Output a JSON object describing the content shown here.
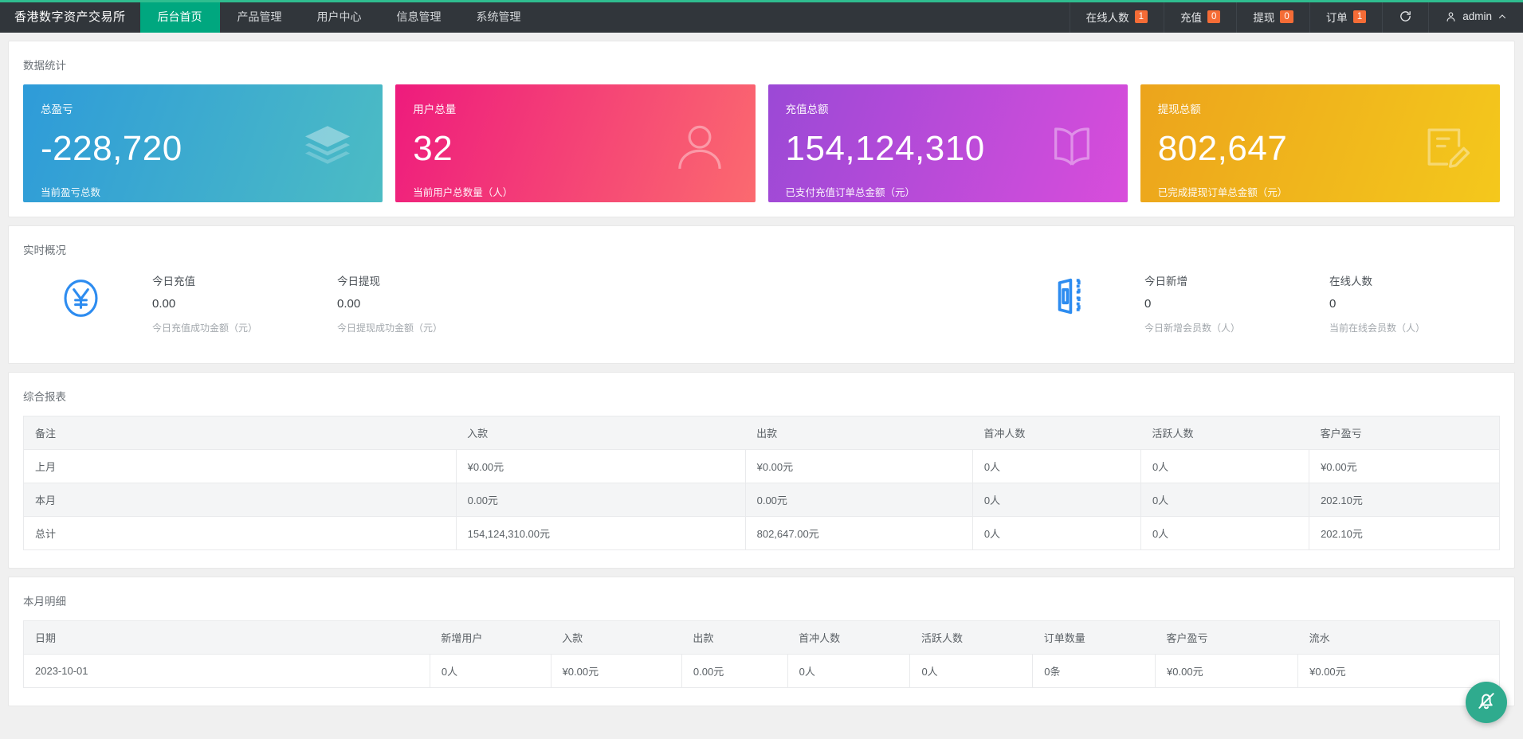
{
  "topbar": {
    "brand": "香港数字资产交易所",
    "nav": [
      {
        "label": "后台首页",
        "active": true
      },
      {
        "label": "产品管理",
        "active": false
      },
      {
        "label": "用户中心",
        "active": false
      },
      {
        "label": "信息管理",
        "active": false
      },
      {
        "label": "系统管理",
        "active": false
      }
    ],
    "right": [
      {
        "label": "在线人数",
        "badge": "1"
      },
      {
        "label": "充值",
        "badge": "0"
      },
      {
        "label": "提现",
        "badge": "0"
      },
      {
        "label": "订单",
        "badge": "1"
      }
    ],
    "refresh_icon": "refresh-icon",
    "user": "admin",
    "accent": "#2fbd8f",
    "badge_color": "#f56c36"
  },
  "stats": {
    "title": "数据统计",
    "cards": [
      {
        "label": "总盈亏",
        "value": "-228,720",
        "sub": "当前盈亏总数",
        "icon": "layers-icon",
        "color": "#2e9bd9"
      },
      {
        "label": "用户总量",
        "value": "32",
        "sub": "当前用户总数量（人）",
        "icon": "user-icon",
        "color": "#ee1b7d"
      },
      {
        "label": "充值总额",
        "value": "154,124,310",
        "sub": "已支付充值订单总金额（元）",
        "icon": "book-icon",
        "color": "#9b49d6"
      },
      {
        "label": "提现总额",
        "value": "802,647",
        "sub": "已完成提现订单总金额（元）",
        "icon": "edit-doc-icon",
        "color": "#eca41c"
      }
    ]
  },
  "realtime": {
    "title": "实时概况",
    "icon_left": "yuan-circle-icon",
    "icon_mid": "card-dashed-icon",
    "blocks_left": [
      {
        "title": "今日充值",
        "value": "0.00",
        "sub": "今日充值成功金额（元）"
      },
      {
        "title": "今日提现",
        "value": "0.00",
        "sub": "今日提现成功金额（元）"
      }
    ],
    "blocks_right": [
      {
        "title": "今日新增",
        "value": "0",
        "sub": "今日新增会员数（人）"
      },
      {
        "title": "在线人数",
        "value": "0",
        "sub": "当前在线会员数（人）"
      }
    ]
  },
  "report": {
    "title": "综合报表",
    "columns": [
      "备注",
      "入款",
      "出款",
      "首冲人数",
      "活跃人数",
      "客户盈亏"
    ],
    "rows": [
      [
        "上月",
        "¥0.00元",
        "¥0.00元",
        "0人",
        "0人",
        "¥0.00元"
      ],
      [
        "本月",
        "0.00元",
        "0.00元",
        "0人",
        "0人",
        "202.10元"
      ],
      [
        "总计",
        "154,124,310.00元",
        "802,647.00元",
        "0人",
        "0人",
        "202.10元"
      ]
    ]
  },
  "detail": {
    "title": "本月明细",
    "columns": [
      "日期",
      "新增用户",
      "入款",
      "出款",
      "首冲人数",
      "活跃人数",
      "订单数量",
      "客户盈亏",
      "流水"
    ],
    "rows": [
      [
        "2023-10-01",
        "0人",
        "¥0.00元",
        "0.00元",
        "0人",
        "0人",
        "0条",
        "¥0.00元",
        "¥0.00元"
      ]
    ]
  },
  "fab": {
    "icon": "mute-bell-icon",
    "color": "#2fab8e"
  }
}
